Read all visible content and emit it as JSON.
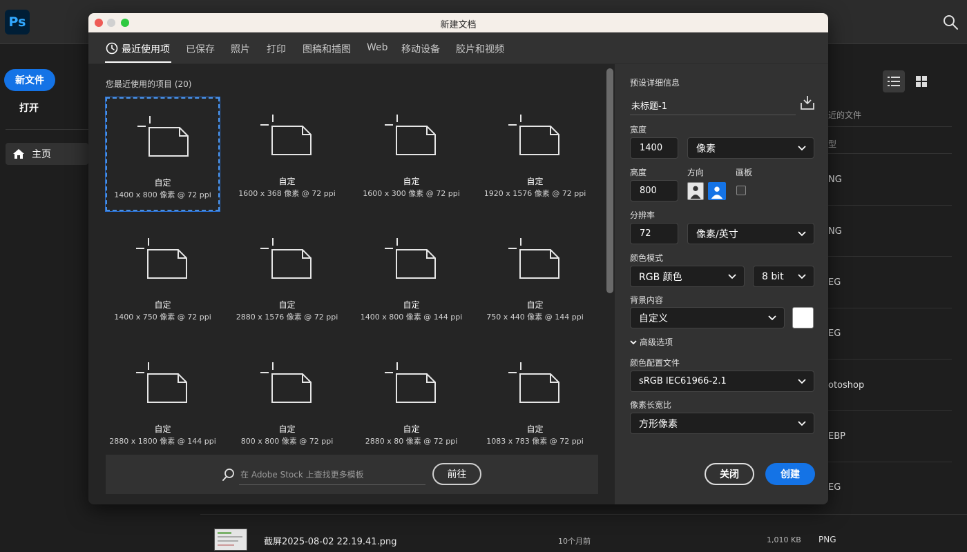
{
  "app": {
    "logo_text": "Ps"
  },
  "sidebar": {
    "new_file_label": "新文件",
    "open_label": "打开",
    "home_label": "主页"
  },
  "background": {
    "col_recent": "近的文件",
    "col_type": "型",
    "rows": [
      "NG",
      "NG",
      "EG",
      "EG",
      "otoshop",
      "EBP",
      "EG"
    ],
    "bottom_row": {
      "name": "截屏2025-08-02 22.19.41.png",
      "time": "10个月前",
      "size": "1,010 KB",
      "type": "PNG"
    }
  },
  "dialog": {
    "title": "新建文档",
    "tabs": [
      {
        "label": "最近使用项",
        "active": true
      },
      {
        "label": "已保存"
      },
      {
        "label": "照片"
      },
      {
        "label": "打印"
      },
      {
        "label": "图稿和插图"
      },
      {
        "label": "Web"
      },
      {
        "label": "移动设备"
      },
      {
        "label": "胶片和视频"
      }
    ],
    "recent_header": "您最近使用的项目 (20)",
    "presets": [
      {
        "name": "自定",
        "size": "1400 x 800 像素 @ 72 ppi",
        "selected": true
      },
      {
        "name": "自定",
        "size": "1600 x 368 像素 @ 72 ppi"
      },
      {
        "name": "自定",
        "size": "1600 x 300 像素 @ 72 ppi"
      },
      {
        "name": "自定",
        "size": "1920 x 1576 像素 @ 72 ppi"
      },
      {
        "name": "自定",
        "size": "1400 x 750 像素 @ 72 ppi"
      },
      {
        "name": "自定",
        "size": "2880 x 1576 像素 @ 72 ppi"
      },
      {
        "name": "自定",
        "size": "1400 x 800 像素 @ 144 ppi"
      },
      {
        "name": "自定",
        "size": "750 x 440 像素 @ 144 ppi"
      },
      {
        "name": "自定",
        "size": "2880 x 1800 像素 @ 144 ppi"
      },
      {
        "name": "自定",
        "size": "800 x 800 像素 @ 72 ppi"
      },
      {
        "name": "自定",
        "size": "2880 x 80 像素 @ 72 ppi"
      },
      {
        "name": "自定",
        "size": "1083 x 783 像素 @ 72 ppi"
      }
    ],
    "stock": {
      "placeholder": "在 Adobe Stock 上查找更多模板",
      "go_label": "前往"
    },
    "details": {
      "section_title": "预设详细信息",
      "preset_name": "未标题-1",
      "width_label": "宽度",
      "width_value": "1400",
      "width_unit": "像素",
      "height_label": "高度",
      "height_value": "800",
      "orientation_label": "方向",
      "artboard_label": "画板",
      "resolution_label": "分辨率",
      "resolution_value": "72",
      "resolution_unit": "像素/英寸",
      "color_mode_label": "颜色模式",
      "color_mode_value": "RGB 颜色",
      "bit_depth_value": "8 bit",
      "background_label": "背景内容",
      "background_value": "自定义",
      "background_color": "#ffffff",
      "advanced_label": "高级选项",
      "color_profile_label": "颜色配置文件",
      "color_profile_value": "sRGB IEC61966-2.1",
      "pixel_aspect_label": "像素长宽比",
      "pixel_aspect_value": "方形像素"
    },
    "buttons": {
      "close_label": "关闭",
      "create_label": "创建"
    }
  },
  "colors": {
    "accent": "#1473e6",
    "selection_border": "#4a90e2"
  }
}
